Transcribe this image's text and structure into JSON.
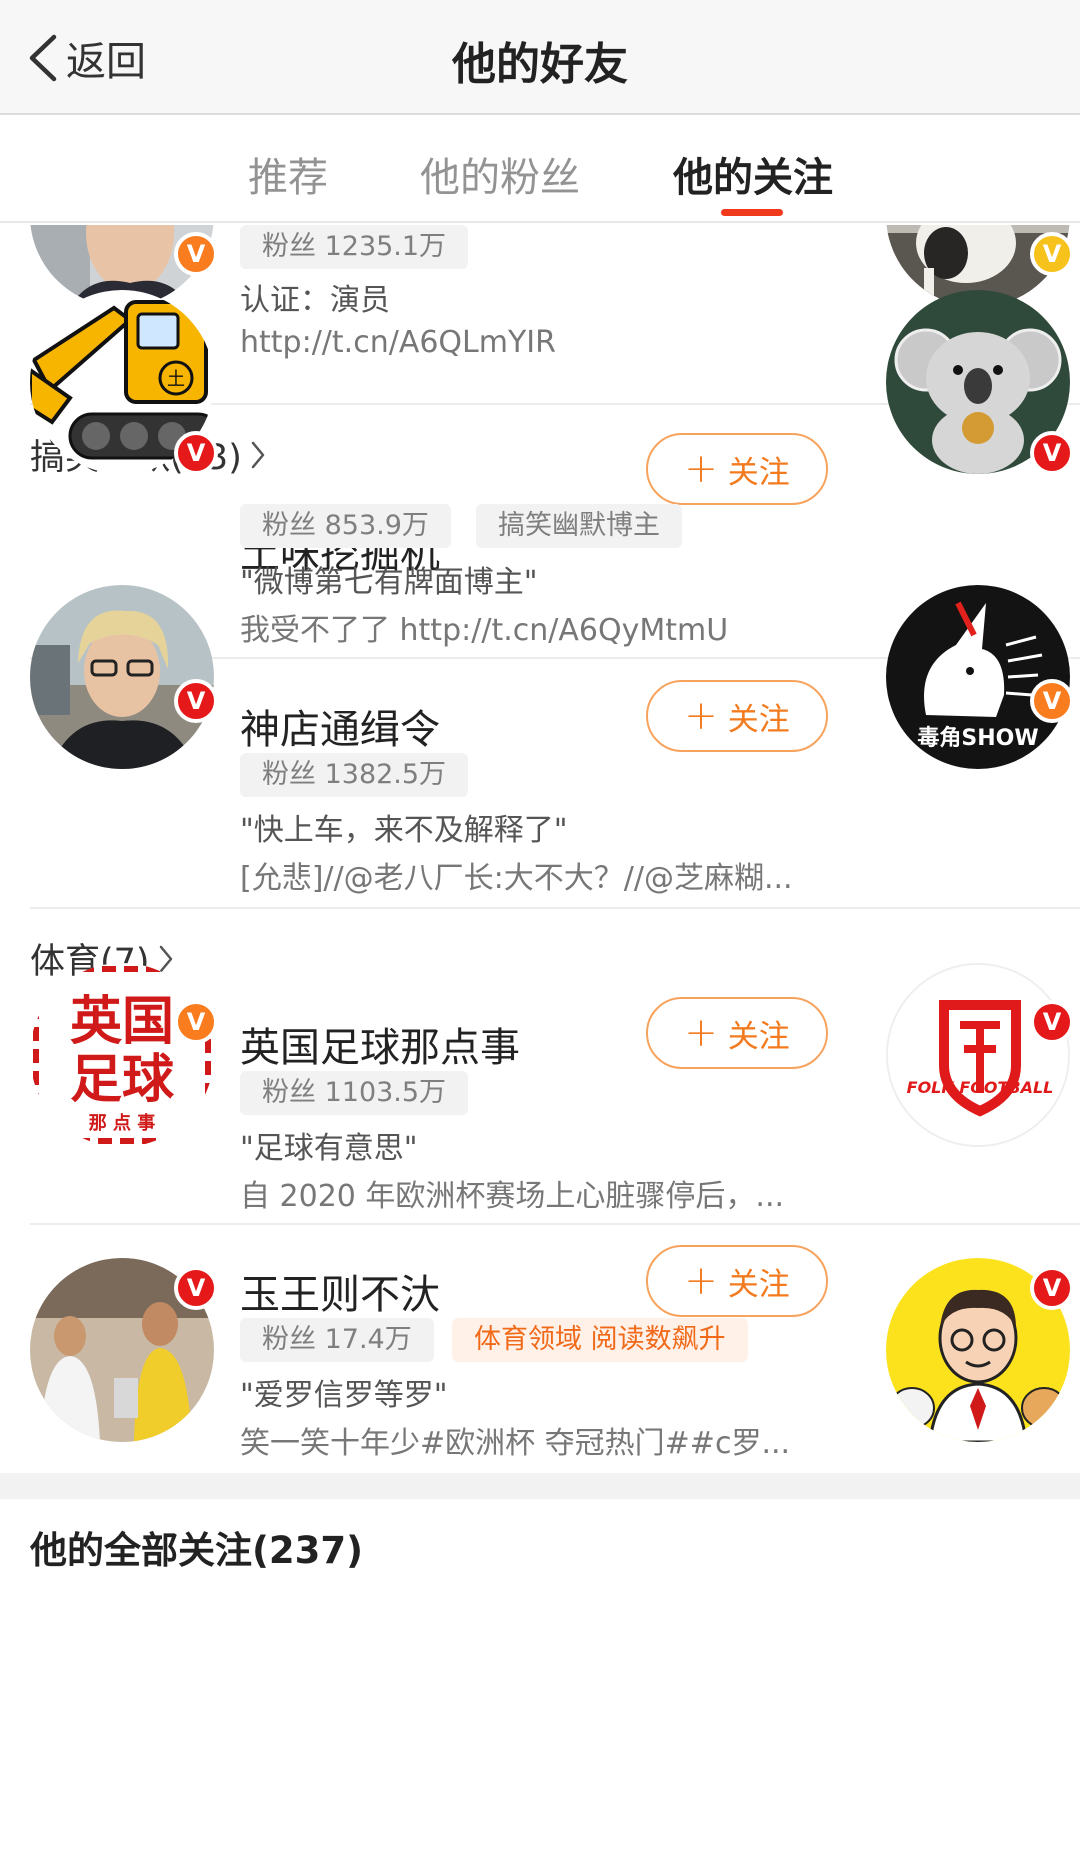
{
  "nav": {
    "back_label": "返回",
    "title": "他的好友"
  },
  "tabs": [
    {
      "label": "推荐",
      "active": false
    },
    {
      "label": "他的粉丝",
      "active": false
    },
    {
      "label": "他的关注",
      "active": true
    }
  ],
  "colors": {
    "accent_red": "#f13a1c",
    "follow_orange": "#f37b1f",
    "verified_red": "#e6191a",
    "verified_orange": "#f97c1e",
    "verified_yellow": "#f6c21b"
  },
  "top_partial": {
    "fans": "粉丝 1235.1万",
    "verification": "认证：演员",
    "link": "http://t.cn/A6QLmYIR",
    "badge": "V"
  },
  "sections": [
    {
      "header": "搞笑幽默(13)",
      "users": [
        {
          "name": "土味挖掘机",
          "fans": "粉丝 853.9万",
          "tag": "搞笑幽默博主",
          "quote": "\"微博第七有牌面博主\"",
          "recent": "我受不了了 http://t.cn/A6QyMtmU",
          "follow_label": "关注",
          "badge": "V"
        },
        {
          "name": "神店通缉令",
          "fans": "粉丝 1382.5万",
          "quote": "\"快上车，来不及解释了\"",
          "recent": "[允悲]//@老八厂长:大不大？//@芝麻糊...",
          "follow_label": "关注",
          "badge": "V",
          "right_avatar_text": "毒角SHOW"
        }
      ]
    },
    {
      "header": "体育(7)",
      "users": [
        {
          "name": "英国足球那点事",
          "fans": "粉丝 1103.5万",
          "quote": "\"足球有意思\"",
          "recent": "自 2020 年欧洲杯赛场上心脏骤停后，...",
          "follow_label": "关注",
          "badge": "V",
          "avatar_text": [
            "英国",
            "足球",
            "那 点 事"
          ],
          "right_avatar_text": "FOLK FOOTBALL"
        },
        {
          "name": "玉王则不汏",
          "fans": "粉丝 17.4万",
          "tag": "体育领域 阅读数飙升",
          "quote": "\"爱罗信罗等罗\"",
          "recent": "笑一笑十年少#欧洲杯 夺冠热门##c罗...",
          "follow_label": "关注",
          "badge": "V"
        }
      ]
    }
  ],
  "footer": {
    "title": "他的全部关注(237)"
  }
}
